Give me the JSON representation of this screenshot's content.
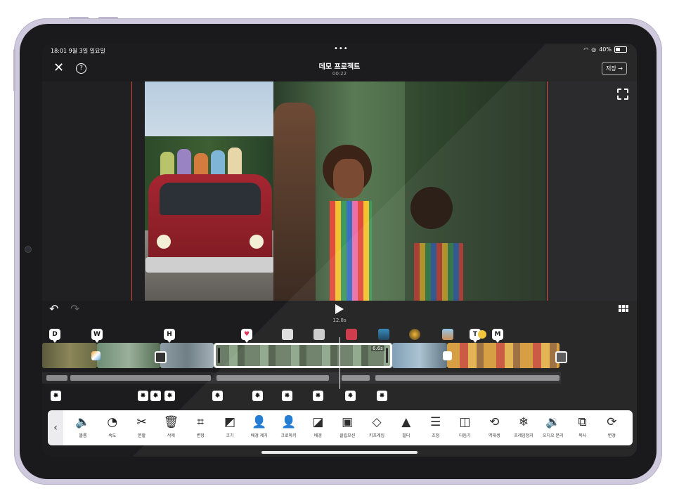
{
  "status": {
    "time": "18:01",
    "date": "9월 3일 일요일",
    "dots": "•••",
    "battery": "40%"
  },
  "header": {
    "title": "데모 프로젝트",
    "duration": "00:22",
    "save_label": "저장 →"
  },
  "playback": {
    "time": "12.8s"
  },
  "timeline": {
    "badges": [
      "D",
      "W",
      "H",
      "M",
      "T"
    ],
    "clip_duration_label": "6.6s"
  },
  "toolbar": {
    "back": "‹",
    "items": [
      {
        "label": "볼륨",
        "icon": "volume-icon",
        "glyph": "🔈"
      },
      {
        "label": "속도",
        "icon": "speed-gauge-icon",
        "glyph": "◔"
      },
      {
        "label": "분할",
        "icon": "scissors-icon",
        "glyph": "✂"
      },
      {
        "label": "삭제",
        "icon": "trash-icon",
        "glyph": "🗑"
      },
      {
        "label": "변형",
        "icon": "crop-icon",
        "glyph": "⌗"
      },
      {
        "label": "크기",
        "icon": "resize-icon",
        "glyph": "◩"
      },
      {
        "label": "배경 제거",
        "icon": "background-remove-icon",
        "glyph": "👤"
      },
      {
        "label": "크로마키",
        "icon": "chroma-key-icon",
        "glyph": "👤"
      },
      {
        "label": "배경",
        "icon": "background-icon",
        "glyph": "◪"
      },
      {
        "label": "클립모션",
        "icon": "clip-motion-icon",
        "glyph": "▣"
      },
      {
        "label": "키프레임",
        "icon": "keyframe-icon",
        "glyph": "◇"
      },
      {
        "label": "필터",
        "icon": "filter-icon",
        "glyph": "▲"
      },
      {
        "label": "조정",
        "icon": "adjust-sliders-icon",
        "glyph": "☰"
      },
      {
        "label": "다듬기",
        "icon": "trim-icon",
        "glyph": "◫"
      },
      {
        "label": "역재생",
        "icon": "reverse-icon",
        "glyph": "⟲"
      },
      {
        "label": "프레임정지",
        "icon": "freeze-frame-icon",
        "glyph": "❄"
      },
      {
        "label": "오디오 분리",
        "icon": "audio-split-icon",
        "glyph": "🔉"
      },
      {
        "label": "복사",
        "icon": "copy-icon",
        "glyph": "⧉"
      },
      {
        "label": "변경",
        "icon": "replace-icon",
        "glyph": "⟳"
      }
    ]
  }
}
